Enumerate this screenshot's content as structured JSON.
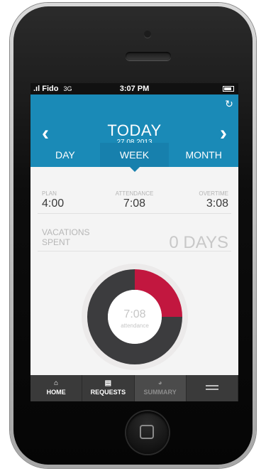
{
  "status": {
    "carrier": "Fido",
    "network": "3G",
    "time": "3:07 PM"
  },
  "header": {
    "title": "TODAY",
    "date": "27.08.2013"
  },
  "tabs": [
    {
      "label": "DAY"
    },
    {
      "label": "WEEK"
    },
    {
      "label": "MONTH"
    }
  ],
  "selected_tab": "WEEK",
  "stats": {
    "plan": {
      "label": "PLAN",
      "value": "4:00"
    },
    "attendance": {
      "label": "ATTENDANCE",
      "value": "7:08"
    },
    "overtime": {
      "label": "OVERTIME",
      "value": "3:08"
    }
  },
  "vacations": {
    "label": "VACATIONS SPENT",
    "value": "0 DAYS"
  },
  "chart": {
    "center_value": "7:08",
    "center_label": "attendance",
    "segments": [
      {
        "name": "attendance",
        "fraction": 0.25,
        "color": "#c2173f"
      },
      {
        "name": "remaining",
        "fraction": 0.75,
        "color": "#3c3c3e"
      }
    ]
  },
  "bottom_nav": [
    {
      "label": "HOME",
      "icon": "home-icon"
    },
    {
      "label": "REQUESTS",
      "icon": "document-icon"
    },
    {
      "label": "SUMMARY",
      "icon": "pie-icon"
    },
    {
      "label": "",
      "icon": "menu-icon"
    }
  ],
  "colors": {
    "accent": "#1a8ab7",
    "tab_active": "#1780ad",
    "donut_red": "#c2173f",
    "donut_dark": "#3c3c3e",
    "nav_bg": "#3a3a3a"
  }
}
